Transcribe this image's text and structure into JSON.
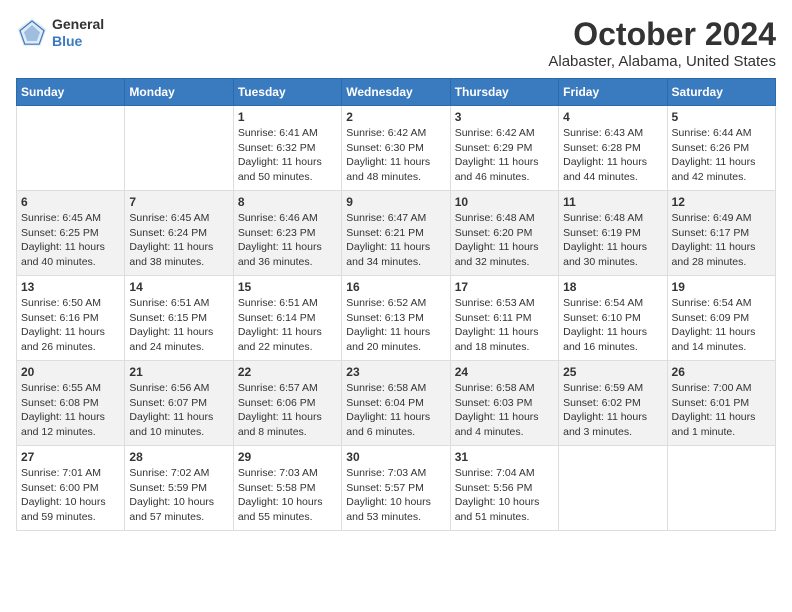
{
  "logo": {
    "line1": "General",
    "line2": "Blue"
  },
  "title": "October 2024",
  "subtitle": "Alabaster, Alabama, United States",
  "days": [
    "Sunday",
    "Monday",
    "Tuesday",
    "Wednesday",
    "Thursday",
    "Friday",
    "Saturday"
  ],
  "weeks": [
    [
      {
        "num": "",
        "info": ""
      },
      {
        "num": "",
        "info": ""
      },
      {
        "num": "1",
        "info": "Sunrise: 6:41 AM\nSunset: 6:32 PM\nDaylight: 11 hours and 50 minutes."
      },
      {
        "num": "2",
        "info": "Sunrise: 6:42 AM\nSunset: 6:30 PM\nDaylight: 11 hours and 48 minutes."
      },
      {
        "num": "3",
        "info": "Sunrise: 6:42 AM\nSunset: 6:29 PM\nDaylight: 11 hours and 46 minutes."
      },
      {
        "num": "4",
        "info": "Sunrise: 6:43 AM\nSunset: 6:28 PM\nDaylight: 11 hours and 44 minutes."
      },
      {
        "num": "5",
        "info": "Sunrise: 6:44 AM\nSunset: 6:26 PM\nDaylight: 11 hours and 42 minutes."
      }
    ],
    [
      {
        "num": "6",
        "info": "Sunrise: 6:45 AM\nSunset: 6:25 PM\nDaylight: 11 hours and 40 minutes."
      },
      {
        "num": "7",
        "info": "Sunrise: 6:45 AM\nSunset: 6:24 PM\nDaylight: 11 hours and 38 minutes."
      },
      {
        "num": "8",
        "info": "Sunrise: 6:46 AM\nSunset: 6:23 PM\nDaylight: 11 hours and 36 minutes."
      },
      {
        "num": "9",
        "info": "Sunrise: 6:47 AM\nSunset: 6:21 PM\nDaylight: 11 hours and 34 minutes."
      },
      {
        "num": "10",
        "info": "Sunrise: 6:48 AM\nSunset: 6:20 PM\nDaylight: 11 hours and 32 minutes."
      },
      {
        "num": "11",
        "info": "Sunrise: 6:48 AM\nSunset: 6:19 PM\nDaylight: 11 hours and 30 minutes."
      },
      {
        "num": "12",
        "info": "Sunrise: 6:49 AM\nSunset: 6:17 PM\nDaylight: 11 hours and 28 minutes."
      }
    ],
    [
      {
        "num": "13",
        "info": "Sunrise: 6:50 AM\nSunset: 6:16 PM\nDaylight: 11 hours and 26 minutes."
      },
      {
        "num": "14",
        "info": "Sunrise: 6:51 AM\nSunset: 6:15 PM\nDaylight: 11 hours and 24 minutes."
      },
      {
        "num": "15",
        "info": "Sunrise: 6:51 AM\nSunset: 6:14 PM\nDaylight: 11 hours and 22 minutes."
      },
      {
        "num": "16",
        "info": "Sunrise: 6:52 AM\nSunset: 6:13 PM\nDaylight: 11 hours and 20 minutes."
      },
      {
        "num": "17",
        "info": "Sunrise: 6:53 AM\nSunset: 6:11 PM\nDaylight: 11 hours and 18 minutes."
      },
      {
        "num": "18",
        "info": "Sunrise: 6:54 AM\nSunset: 6:10 PM\nDaylight: 11 hours and 16 minutes."
      },
      {
        "num": "19",
        "info": "Sunrise: 6:54 AM\nSunset: 6:09 PM\nDaylight: 11 hours and 14 minutes."
      }
    ],
    [
      {
        "num": "20",
        "info": "Sunrise: 6:55 AM\nSunset: 6:08 PM\nDaylight: 11 hours and 12 minutes."
      },
      {
        "num": "21",
        "info": "Sunrise: 6:56 AM\nSunset: 6:07 PM\nDaylight: 11 hours and 10 minutes."
      },
      {
        "num": "22",
        "info": "Sunrise: 6:57 AM\nSunset: 6:06 PM\nDaylight: 11 hours and 8 minutes."
      },
      {
        "num": "23",
        "info": "Sunrise: 6:58 AM\nSunset: 6:04 PM\nDaylight: 11 hours and 6 minutes."
      },
      {
        "num": "24",
        "info": "Sunrise: 6:58 AM\nSunset: 6:03 PM\nDaylight: 11 hours and 4 minutes."
      },
      {
        "num": "25",
        "info": "Sunrise: 6:59 AM\nSunset: 6:02 PM\nDaylight: 11 hours and 3 minutes."
      },
      {
        "num": "26",
        "info": "Sunrise: 7:00 AM\nSunset: 6:01 PM\nDaylight: 11 hours and 1 minute."
      }
    ],
    [
      {
        "num": "27",
        "info": "Sunrise: 7:01 AM\nSunset: 6:00 PM\nDaylight: 10 hours and 59 minutes."
      },
      {
        "num": "28",
        "info": "Sunrise: 7:02 AM\nSunset: 5:59 PM\nDaylight: 10 hours and 57 minutes."
      },
      {
        "num": "29",
        "info": "Sunrise: 7:03 AM\nSunset: 5:58 PM\nDaylight: 10 hours and 55 minutes."
      },
      {
        "num": "30",
        "info": "Sunrise: 7:03 AM\nSunset: 5:57 PM\nDaylight: 10 hours and 53 minutes."
      },
      {
        "num": "31",
        "info": "Sunrise: 7:04 AM\nSunset: 5:56 PM\nDaylight: 10 hours and 51 minutes."
      },
      {
        "num": "",
        "info": ""
      },
      {
        "num": "",
        "info": ""
      }
    ]
  ]
}
